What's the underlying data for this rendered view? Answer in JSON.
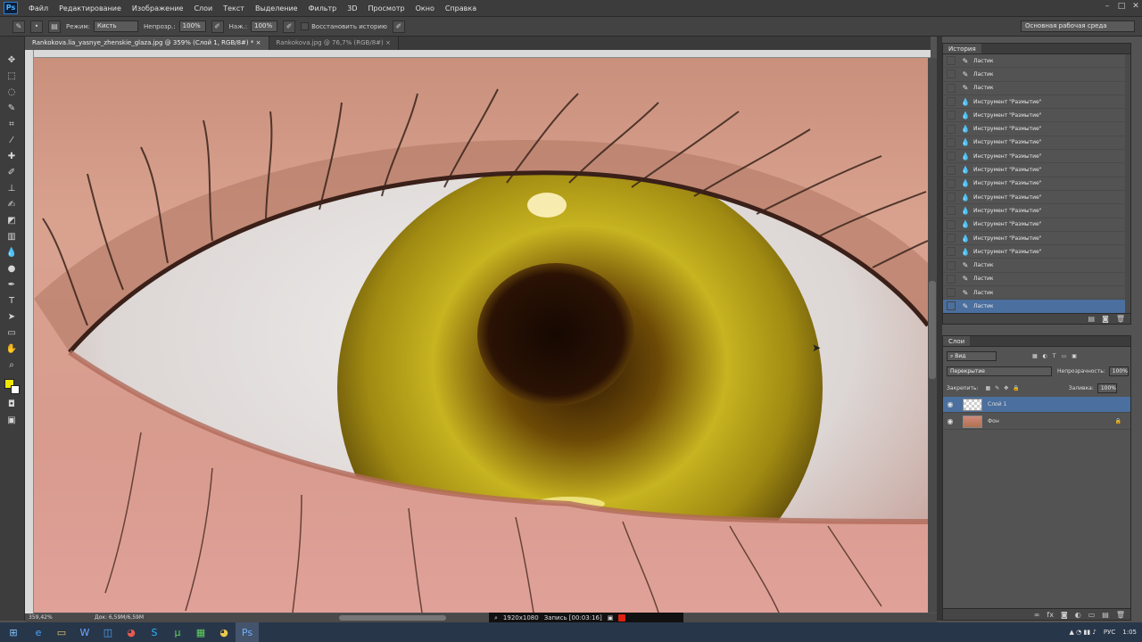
{
  "app": {
    "logo": "Ps"
  },
  "menu": [
    "Файл",
    "Редактирование",
    "Изображение",
    "Слои",
    "Текст",
    "Выделение",
    "Фильтр",
    "3D",
    "Просмотр",
    "Окно",
    "Справка"
  ],
  "options": {
    "mode_label": "Режим:",
    "mode_value": "Кисть",
    "opacity_label": "Непрозр.:",
    "opacity_value": "100%",
    "pressure_label": "Наж.:",
    "pressure_value": "100%",
    "restore_label": "Восстановить историю",
    "workspace": "Основная рабочая среда"
  },
  "tabs": [
    {
      "label": "Rankokova.lia_yasnye_zhenskie_glaza.jpg @ 359% (Слой 1, RGB/8#) *",
      "active": true
    },
    {
      "label": "Rankokova.jpg @ 76,7% (RGB/8#)",
      "active": false
    }
  ],
  "status": {
    "zoom": "359,42%",
    "doc": "Док: 6,59M/6,59M",
    "resolution": "1920x1080",
    "record": "Запись [00:03:16]"
  },
  "history": {
    "title": "История",
    "items": [
      {
        "label": "Ластик",
        "icon": "eraser-icon"
      },
      {
        "label": "Ластик",
        "icon": "eraser-icon"
      },
      {
        "label": "Ластик",
        "icon": "eraser-icon"
      },
      {
        "label": "Инструмент \"Размытие\"",
        "icon": "drop-icon"
      },
      {
        "label": "Инструмент \"Размытие\"",
        "icon": "drop-icon"
      },
      {
        "label": "Инструмент \"Размытие\"",
        "icon": "drop-icon"
      },
      {
        "label": "Инструмент \"Размытие\"",
        "icon": "drop-icon"
      },
      {
        "label": "Инструмент \"Размытие\"",
        "icon": "drop-icon"
      },
      {
        "label": "Инструмент \"Размытие\"",
        "icon": "drop-icon"
      },
      {
        "label": "Инструмент \"Размытие\"",
        "icon": "drop-icon"
      },
      {
        "label": "Инструмент \"Размытие\"",
        "icon": "drop-icon"
      },
      {
        "label": "Инструмент \"Размытие\"",
        "icon": "drop-icon"
      },
      {
        "label": "Инструмент \"Размытие\"",
        "icon": "drop-icon"
      },
      {
        "label": "Инструмент \"Размытие\"",
        "icon": "drop-icon"
      },
      {
        "label": "Инструмент \"Размытие\"",
        "icon": "drop-icon"
      },
      {
        "label": "Ластик",
        "icon": "eraser-icon"
      },
      {
        "label": "Ластик",
        "icon": "eraser-icon"
      },
      {
        "label": "Ластик",
        "icon": "eraser-icon"
      },
      {
        "label": "Ластик",
        "icon": "eraser-icon",
        "selected": true
      }
    ]
  },
  "layers": {
    "title": "Слои",
    "filter": "Вид",
    "blend": "Перекрытие",
    "opacity_label": "Непрозрачность:",
    "opacity_value": "100%",
    "lock_label": "Закрепить:",
    "fill_label": "Заливка:",
    "fill_value": "100%",
    "items": [
      {
        "name": "Слой 1",
        "selected": true
      },
      {
        "name": "Фон",
        "locked": true
      }
    ]
  },
  "taskbar": {
    "items": [
      "windows-start",
      "ie",
      "explorer",
      "word",
      "outlook",
      "chrome",
      "skype",
      "utorrent",
      "sheets",
      "chrome-2",
      "photoshop"
    ],
    "lang": "РУС",
    "time": "1:05"
  },
  "colors": {
    "iris": "#c9b81c",
    "skin": "#d59a88",
    "selection": "#4b6f9e"
  }
}
